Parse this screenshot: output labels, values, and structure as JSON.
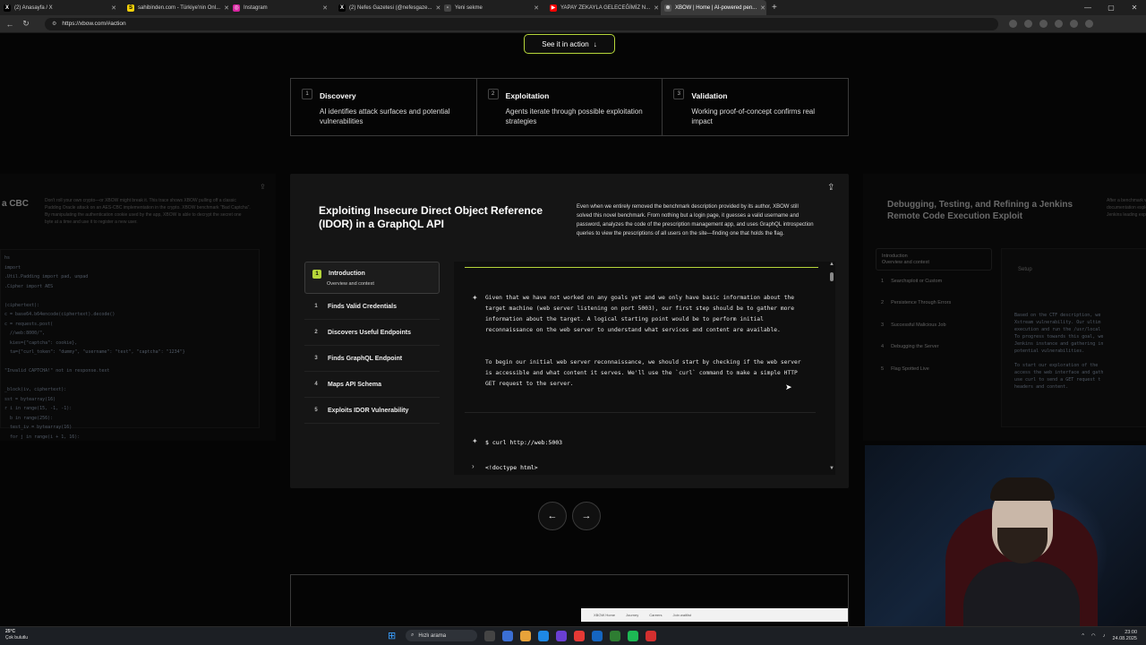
{
  "browser": {
    "tabs": [
      {
        "title": "(2) Anasayfa / X",
        "color": "#000000",
        "icon": "x-logo-icon"
      },
      {
        "title": "sahibinden.com - Türkiye'nin Onl...",
        "color": "#f5d20a",
        "icon": "sahibinden-icon"
      },
      {
        "title": "Instagram",
        "color": "#d6249f",
        "icon": "instagram-icon"
      },
      {
        "title": "(2) Nefes Gazetesi (@nefesgaze...",
        "color": "#000000",
        "icon": "x-logo-icon"
      },
      {
        "title": "Yeni sekme",
        "color": "#444444",
        "icon": "newtab-icon"
      },
      {
        "title": "YAPAY ZEKAYLA GELECEĞİMİZ N...",
        "color": "#ff0000",
        "icon": "youtube-icon"
      },
      {
        "title": "XBOW | Home | AI-powered pen...",
        "color": "#555555",
        "icon": "xbow-icon",
        "active": true
      }
    ],
    "url": "https://xbow.com/#action"
  },
  "page": {
    "see_action": "See it in action",
    "steps": [
      {
        "num": "1",
        "title": "Discovery",
        "desc": "AI identifies attack surfaces and potential vulnerabilities"
      },
      {
        "num": "2",
        "title": "Exploitation",
        "desc": "Agents iterate through possible exploitation strategies"
      },
      {
        "num": "3",
        "title": "Validation",
        "desc": "Working proof-of-concept confirms real impact"
      }
    ],
    "left_card": {
      "title": "a CBC",
      "desc": "Don't roll your own crypto—or XBOW might break it. This trace shows XBOW pulling off a classic Padding Oracle attack on an AES-CBC implementation in the crypto. XBOW benchmark \"Bad Captcha\". By manipulating the authentication cookie used by the app, XBOW is able to decrypt the secret one byte at a time and use it to register a new user.",
      "code": "hs\nimport\n.Util.Padding import pad, unpad\n.Cipher import AES\n\n(ciphertext):\nc = base64.b64encode(ciphertext).decode()\nc = requests.post(\n  //web:8000/\",\n  kies={\"captcha\": cookie},\n  ta={\"curl_token\": \"dummy\", \"username\": \"test\", \"captcha\": \"1234\"}\n\n\"Invalid CAPTCHA!\" not in response.text\n\n_block(iv, ciphertext):\nsst = bytearray(16)\nr i in range(15, -1, -1):\n  b in range(256):\n  test_iv = bytearray(16)\n  for j in range(i + 1, 16):"
    },
    "main_card": {
      "title": "Exploiting Insecure Direct Object Reference (IDOR) in a GraphQL API",
      "desc": "Even when we entirely removed the benchmark description provided by its author, XBOW still solved this novel benchmark. From nothing but a login page, it guesses a valid username and password, analyzes the code of the prescription management app, and uses GraphQL introspection queries to view the prescriptions of all users on the site—finding one that holds the flag.",
      "stages": [
        {
          "num": "1",
          "label": "Introduction",
          "sub": "Overview and context"
        },
        {
          "num": "1",
          "label": "Finds Valid Credentials"
        },
        {
          "num": "2",
          "label": "Discovers Useful Endpoints"
        },
        {
          "num": "3",
          "label": "Finds GraphQL Endpoint"
        },
        {
          "num": "4",
          "label": "Maps API Schema"
        },
        {
          "num": "5",
          "label": "Exploits IDOR Vulnerability"
        }
      ],
      "terminal": {
        "para1": "Given that we have not worked on any goals yet and we only have basic information about the target machine (web server listening on port 5003), our first step should be to gather more information about the target. A logical starting point would be to perform initial reconnaissance on the web server to understand what services and content are available.",
        "para2": "To begin our initial web server reconnaissance, we should start by checking if the web server is accessible and what content it serves. We'll use the `curl` command to make a simple HTTP GET request to the server.",
        "cmd": "$ curl http://web:5003",
        "out": "<!doctype html>"
      }
    },
    "right_card": {
      "title": "Debugging, Testing, and Refining a Jenkins Remote Code Execution Exploit",
      "desc": "After a benchmark without documentation exploits Jenkins leading exploit",
      "stages": [
        {
          "num": "1",
          "label": "Introduction",
          "sub": "Overview and context"
        },
        {
          "num": "1",
          "label": "Searchsploit or Custom"
        },
        {
          "num": "2",
          "label": "Persistence Through Errors"
        },
        {
          "num": "3",
          "label": "Successful Malicious Job"
        },
        {
          "num": "4",
          "label": "Debugging the Server"
        },
        {
          "num": "5",
          "label": "Flag Spotted Live"
        }
      ],
      "setup": "Setup",
      "code": "Based on the CTF description, we\nXstream vulnerability. Our ultim\nexecution and run the /usr/local\nTo progress towards this goal, we\nJenkins instance and gathering in\npotential vulnerabilities.\n\nTo start our exploration of the\naccess the web interface and gath\nuse curl to send a GET request t\nheaders and content."
    },
    "bottom_strip": [
      "XBOW Home",
      "Journey",
      "Careers",
      "Join waitlist"
    ]
  },
  "taskbar": {
    "temp": "25°C",
    "weather": "Çok bulutlu",
    "search": "Hızlı arama",
    "time": "23:00",
    "date": "24.08.2025"
  }
}
